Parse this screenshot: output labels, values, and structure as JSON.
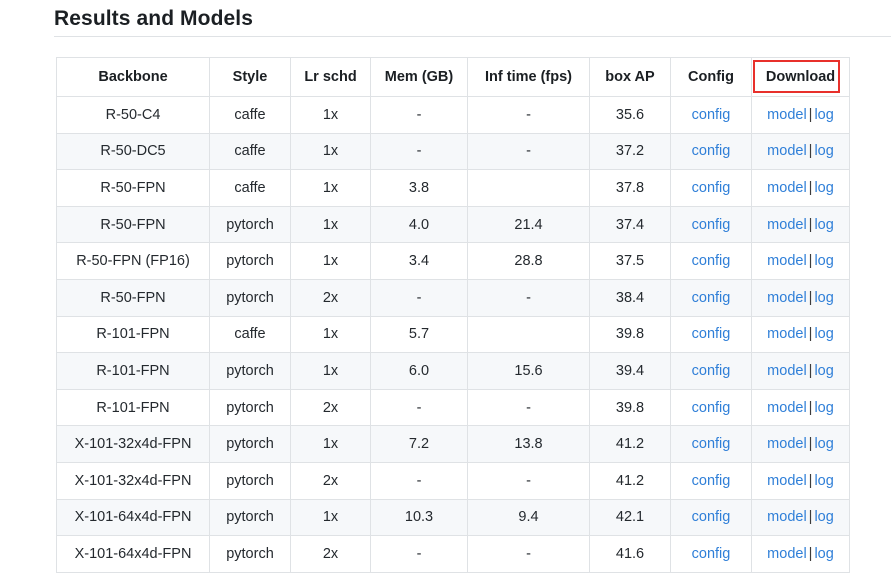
{
  "page": {
    "title": "Results and Models"
  },
  "highlight": {
    "target": "Download",
    "color": "#e8302b"
  },
  "table": {
    "columns": [
      "Backbone",
      "Style",
      "Lr schd",
      "Mem (GB)",
      "Inf time (fps)",
      "box AP",
      "Config",
      "Download"
    ],
    "link_labels": {
      "config": "config",
      "model": "model",
      "log": "log",
      "separator": "|"
    },
    "link_color": "#2f7fd8",
    "rows": [
      {
        "backbone": "R-50-C4",
        "style": "caffe",
        "lr_schd": "1x",
        "mem_gb": "-",
        "inf_time_fps": "-",
        "box_ap": "35.6",
        "config": "config",
        "model": "model",
        "log": "log"
      },
      {
        "backbone": "R-50-DC5",
        "style": "caffe",
        "lr_schd": "1x",
        "mem_gb": "-",
        "inf_time_fps": "-",
        "box_ap": "37.2",
        "config": "config",
        "model": "model",
        "log": "log"
      },
      {
        "backbone": "R-50-FPN",
        "style": "caffe",
        "lr_schd": "1x",
        "mem_gb": "3.8",
        "inf_time_fps": "",
        "box_ap": "37.8",
        "config": "config",
        "model": "model",
        "log": "log"
      },
      {
        "backbone": "R-50-FPN",
        "style": "pytorch",
        "lr_schd": "1x",
        "mem_gb": "4.0",
        "inf_time_fps": "21.4",
        "box_ap": "37.4",
        "config": "config",
        "model": "model",
        "log": "log"
      },
      {
        "backbone": "R-50-FPN (FP16)",
        "style": "pytorch",
        "lr_schd": "1x",
        "mem_gb": "3.4",
        "inf_time_fps": "28.8",
        "box_ap": "37.5",
        "config": "config",
        "model": "model",
        "log": "log"
      },
      {
        "backbone": "R-50-FPN",
        "style": "pytorch",
        "lr_schd": "2x",
        "mem_gb": "-",
        "inf_time_fps": "-",
        "box_ap": "38.4",
        "config": "config",
        "model": "model",
        "log": "log"
      },
      {
        "backbone": "R-101-FPN",
        "style": "caffe",
        "lr_schd": "1x",
        "mem_gb": "5.7",
        "inf_time_fps": "",
        "box_ap": "39.8",
        "config": "config",
        "model": "model",
        "log": "log"
      },
      {
        "backbone": "R-101-FPN",
        "style": "pytorch",
        "lr_schd": "1x",
        "mem_gb": "6.0",
        "inf_time_fps": "15.6",
        "box_ap": "39.4",
        "config": "config",
        "model": "model",
        "log": "log"
      },
      {
        "backbone": "R-101-FPN",
        "style": "pytorch",
        "lr_schd": "2x",
        "mem_gb": "-",
        "inf_time_fps": "-",
        "box_ap": "39.8",
        "config": "config",
        "model": "model",
        "log": "log"
      },
      {
        "backbone": "X-101-32x4d-FPN",
        "style": "pytorch",
        "lr_schd": "1x",
        "mem_gb": "7.2",
        "inf_time_fps": "13.8",
        "box_ap": "41.2",
        "config": "config",
        "model": "model",
        "log": "log"
      },
      {
        "backbone": "X-101-32x4d-FPN",
        "style": "pytorch",
        "lr_schd": "2x",
        "mem_gb": "-",
        "inf_time_fps": "-",
        "box_ap": "41.2",
        "config": "config",
        "model": "model",
        "log": "log"
      },
      {
        "backbone": "X-101-64x4d-FPN",
        "style": "pytorch",
        "lr_schd": "1x",
        "mem_gb": "10.3",
        "inf_time_fps": "9.4",
        "box_ap": "42.1",
        "config": "config",
        "model": "model",
        "log": "log"
      },
      {
        "backbone": "X-101-64x4d-FPN",
        "style": "pytorch",
        "lr_schd": "2x",
        "mem_gb": "-",
        "inf_time_fps": "-",
        "box_ap": "41.6",
        "config": "config",
        "model": "model",
        "log": "log"
      }
    ]
  }
}
